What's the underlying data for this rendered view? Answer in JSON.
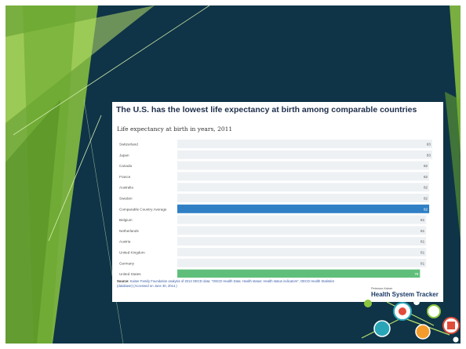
{
  "chart_data": {
    "type": "bar",
    "orientation": "horizontal",
    "title": "The U.S. has the lowest life expectancy at birth among comparable countries",
    "subtitle": "Life expectancy at birth in years, 2011",
    "categories": [
      "Switzerland",
      "Japan",
      "Canada",
      "France",
      "Australia",
      "Sweden",
      "Comparable Country Average",
      "Belgium",
      "Netherlands",
      "Austria",
      "United Kingdom",
      "Germany",
      "United States"
    ],
    "values": [
      83,
      83,
      82,
      82,
      82,
      82,
      82,
      81,
      81,
      81,
      81,
      81,
      79
    ],
    "value_labels": [
      "83",
      "83",
      "82",
      "82",
      "82",
      "82",
      "82",
      "81",
      "81",
      "81",
      "81",
      "81",
      "79"
    ],
    "highlight": {
      "Comparable Country Average": "#2f7fc5",
      "United States": "#5fbf7a"
    },
    "bar_color": "#eef1f4",
    "xlim": [
      0,
      83
    ]
  },
  "source": {
    "label": "Source:",
    "text": "Kaiser Family Foundation analysis of 2013 OECD data: \"OECD Health Data: Health status: Health status indicators\", OECD Health Statistics (database) (Accessed on June 30, 2014.)"
  },
  "logo": {
    "top": "Peterson-Kaiser",
    "name": "Health System Tracker"
  },
  "colors": {
    "background": "#0f3447",
    "accent_green": "#8cc63f",
    "title": "#1d2e4a"
  }
}
